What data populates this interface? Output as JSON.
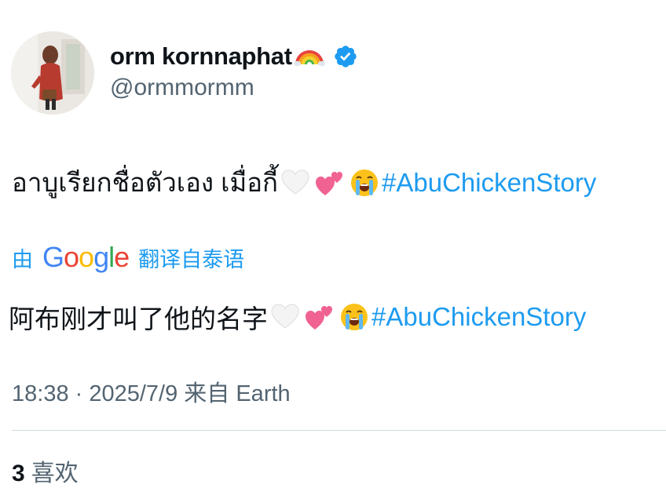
{
  "user": {
    "display_name": "orm kornnaphat",
    "handle": "@ormmormm",
    "verified": true,
    "name_emoji": "rainbow-icon"
  },
  "tweet": {
    "text": "อาบูเรียกชื่อตัวเอง เมื่อกี้",
    "emojis": [
      "white-heart-icon",
      "two-hearts-icon",
      "loudly-crying-face-icon"
    ],
    "hashtag": "#AbuChickenStory"
  },
  "translation": {
    "by_label": "由",
    "provider": "Google",
    "action_label": "翻译自泰语",
    "text": "阿布刚才叫了他的名字",
    "hashtag": "#AbuChickenStory"
  },
  "meta": {
    "timestamp": "18:38 · 2025/7/9 来自 Earth"
  },
  "stats": {
    "likes_count": "3",
    "likes_label": "喜欢"
  },
  "colors": {
    "link": "#1d9bf0",
    "secondary_text": "#536471",
    "primary_text": "#0f1419",
    "divider": "#cfd9de",
    "verified_badge": "#1d9bf0"
  }
}
